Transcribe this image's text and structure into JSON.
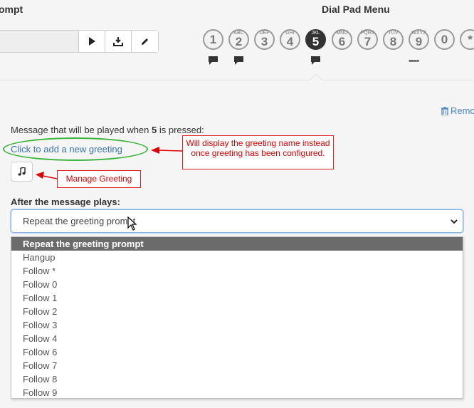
{
  "header": {
    "prompt_title": "ompt",
    "dial_title": "Dial Pad Menu"
  },
  "prompt_tools": [
    {
      "name": "play-icon"
    },
    {
      "name": "download-icon"
    },
    {
      "name": "edit-icon"
    }
  ],
  "dial_keys": [
    {
      "num": "1",
      "letters": "",
      "active": false,
      "bubble": true
    },
    {
      "num": "2",
      "letters": "ABC",
      "active": false,
      "bubble": true
    },
    {
      "num": "3",
      "letters": "DEF",
      "active": false,
      "bubble": false
    },
    {
      "num": "4",
      "letters": "GHI",
      "active": false,
      "bubble": false
    },
    {
      "num": "5",
      "letters": "JKL",
      "active": true,
      "bubble": true
    },
    {
      "num": "6",
      "letters": "MNO",
      "active": false,
      "bubble": false
    },
    {
      "num": "7",
      "letters": "PQRS",
      "active": false,
      "bubble": false
    },
    {
      "num": "8",
      "letters": "TUV",
      "active": false,
      "bubble": false
    },
    {
      "num": "9",
      "letters": "WXYZ",
      "active": false,
      "bubble": false
    },
    {
      "num": "0",
      "letters": "",
      "active": false,
      "bubble": false
    },
    {
      "num": "*",
      "letters": "",
      "active": false,
      "bubble": false
    }
  ],
  "more_indicator": "•••••",
  "remove_link": "Remo",
  "message": {
    "prefix": "Message that will be played when ",
    "key": "5",
    "suffix": " is pressed:"
  },
  "add_greeting_link": "Click to add a new greeting",
  "annotations": {
    "greeting_note": "Will display the greeting name instead once greeting has been configured.",
    "manage_note": "Manage Greeting"
  },
  "after_label": "After the message plays:",
  "select": {
    "value": "Repeat the greeting prompt",
    "options": [
      "Repeat the greeting prompt",
      "Hangup",
      "Follow *",
      "Follow 0",
      "Follow 1",
      "Follow 2",
      "Follow 3",
      "Follow 4",
      "Follow 6",
      "Follow 7",
      "Follow 8",
      "Follow 9"
    ],
    "selected_index": 0
  },
  "colors": {
    "link": "#3a74b0",
    "annotation_red": "#d00000",
    "ellipse_green": "#3cb43c",
    "active_key": "#333333"
  }
}
